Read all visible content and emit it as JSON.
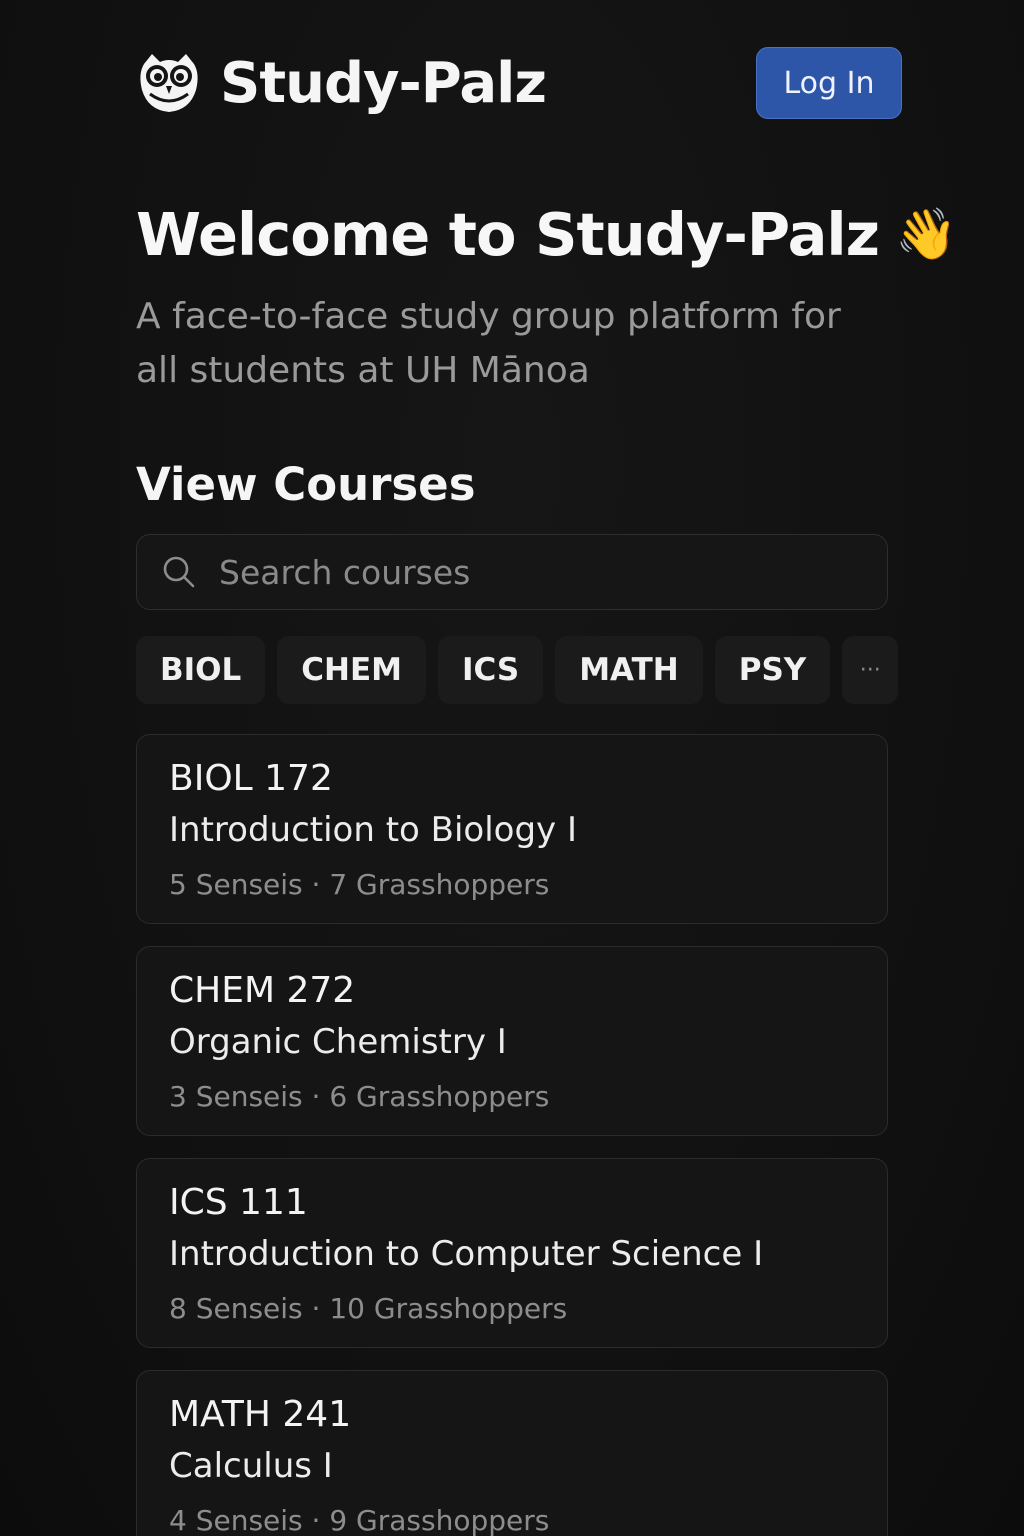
{
  "header": {
    "brand_name": "Study-Palz",
    "logo_icon": "owl-icon",
    "login_label": "Log In",
    "login_color": "#2d55a8"
  },
  "hero": {
    "title": "Welcome to Study-Palz",
    "emoji": "👋",
    "subtitle_line1": "A face-to-face study group platform for",
    "subtitle_line2": "all students at UH Mānoa"
  },
  "courses_section": {
    "title": "View Courses",
    "search": {
      "placeholder": "Search courses",
      "value": "",
      "icon": "search-icon"
    },
    "filters": [
      "BIOL",
      "CHEM",
      "ICS",
      "MATH",
      "PSY"
    ],
    "more_label": "···",
    "courses": [
      {
        "code": "BIOL 172",
        "name": "Introduction to Biology I",
        "meta": "5 Senseis · 7 Grasshoppers"
      },
      {
        "code": "CHEM 272",
        "name": "Organic Chemistry I",
        "meta": "3 Senseis · 6 Grasshoppers"
      },
      {
        "code": "ICS 111",
        "name": "Introduction to Computer Science I",
        "meta": "8 Senseis · 10 Grasshoppers"
      },
      {
        "code": "MATH 241",
        "name": "Calculus I",
        "meta": "4 Senseis · 9 Grasshoppers"
      }
    ]
  }
}
